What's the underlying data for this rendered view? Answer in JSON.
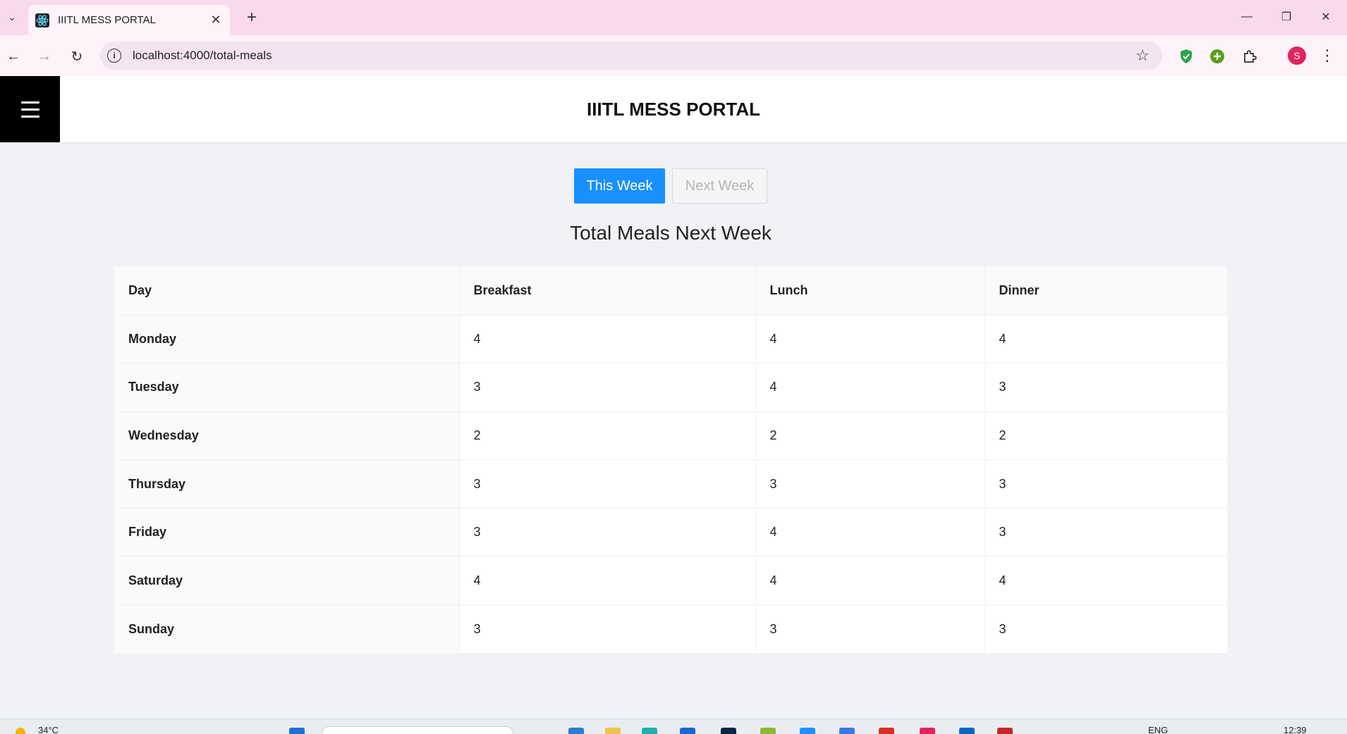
{
  "browser": {
    "tab_title": "IIITL MESS PORTAL",
    "new_tab": "+",
    "url": "localhost:4000/total-meals",
    "avatar_letter": "S",
    "icons": [
      "tab-search-icon",
      "react-favicon-icon",
      "close-icon",
      "back-arrow-icon",
      "forward-arrow-icon",
      "reload-icon",
      "site-info-icon",
      "star-icon",
      "shield-extension-icon",
      "plus-extension-icon",
      "puzzle-extensions-icon",
      "kebab-menu-icon",
      "minimize-icon",
      "restore-icon",
      "window-close-icon"
    ]
  },
  "header": {
    "title": "IIITL MESS PORTAL"
  },
  "week_toggle": {
    "this_week": "This Week",
    "next_week": "Next Week",
    "active": "this_week",
    "active_color": "#1890ff"
  },
  "heading": "Total Meals Next Week",
  "table": {
    "columns": [
      "Day",
      "Breakfast",
      "Lunch",
      "Dinner"
    ],
    "rows": [
      {
        "day": "Monday",
        "breakfast": "4",
        "lunch": "4",
        "dinner": "4"
      },
      {
        "day": "Tuesday",
        "breakfast": "3",
        "lunch": "4",
        "dinner": "3"
      },
      {
        "day": "Wednesday",
        "breakfast": "2",
        "lunch": "2",
        "dinner": "2"
      },
      {
        "day": "Thursday",
        "breakfast": "3",
        "lunch": "3",
        "dinner": "3"
      },
      {
        "day": "Friday",
        "breakfast": "3",
        "lunch": "4",
        "dinner": "3"
      },
      {
        "day": "Saturday",
        "breakfast": "4",
        "lunch": "4",
        "dinner": "4"
      },
      {
        "day": "Sunday",
        "breakfast": "3",
        "lunch": "3",
        "dinner": "3"
      }
    ]
  },
  "taskbar": {
    "weather": "34°C",
    "language": "ENG",
    "time": "12:39"
  }
}
